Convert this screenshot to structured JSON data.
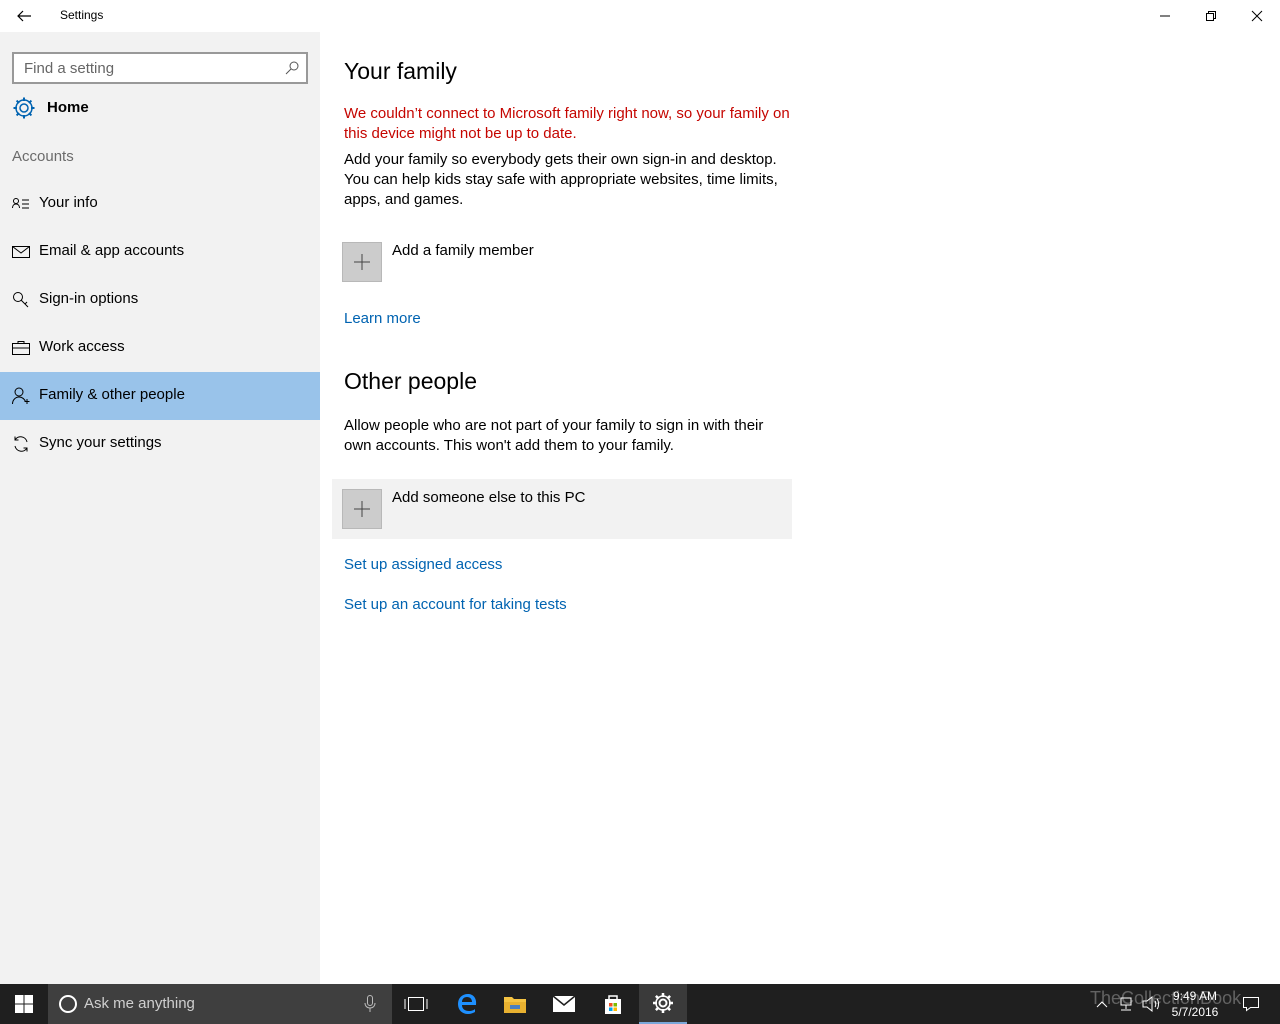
{
  "window": {
    "title": "Settings"
  },
  "sidebar": {
    "search_placeholder": "Find a setting",
    "home_label": "Home",
    "section_label": "Accounts",
    "items": [
      {
        "label": "Your info",
        "icon": "contact-card-icon",
        "active": false
      },
      {
        "label": "Email & app accounts",
        "icon": "mail-icon",
        "active": false
      },
      {
        "label": "Sign-in options",
        "icon": "key-icon",
        "active": false
      },
      {
        "label": "Work access",
        "icon": "briefcase-icon",
        "active": false
      },
      {
        "label": "Family & other people",
        "icon": "add-person-icon",
        "active": true
      },
      {
        "label": "Sync your settings",
        "icon": "sync-icon",
        "active": false
      }
    ]
  },
  "main": {
    "family": {
      "title": "Your family",
      "error": "We couldn’t connect to Microsoft family right now, so your family on this device might not be up to date.",
      "description": "Add your family so everybody gets their own sign-in and desktop. You can help kids stay safe with appropriate websites, time limits, apps, and games.",
      "add_label": "Add a family member",
      "learn_more": "Learn more"
    },
    "other": {
      "title": "Other people",
      "description": "Allow people who are not part of your family to sign in with their own accounts. This won't add them to your family.",
      "add_label": "Add someone else to this PC",
      "link1": "Set up assigned access",
      "link2": "Set up an account for taking tests"
    }
  },
  "taskbar": {
    "search_placeholder": "Ask me anything",
    "time": "9:49 AM",
    "date": "5/7/2016",
    "watermark": "TheCollectionBook"
  },
  "colors": {
    "accent": "#0063b1",
    "selected": "#99c3ea",
    "error": "#c50500"
  }
}
